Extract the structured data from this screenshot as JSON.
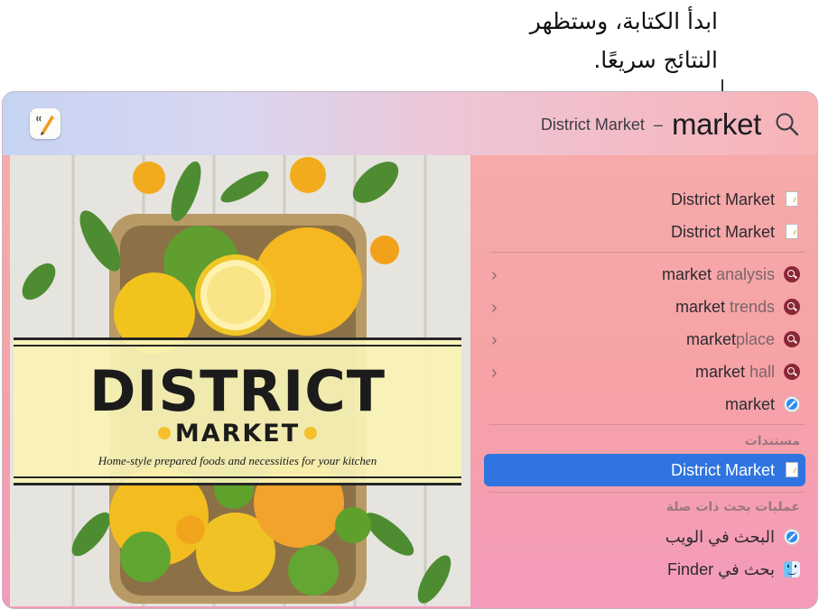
{
  "callout": {
    "line1": "ابدأ الكتابة، وستظهر",
    "line2": "النتائج سريعًا."
  },
  "app": {
    "icon": "pages-app-icon"
  },
  "search": {
    "query": "market",
    "hint": "District Market",
    "separator": "–",
    "icon": "magnifying-glass-icon"
  },
  "preview": {
    "title": "DISTRICT",
    "subtitle": "MARKET",
    "tagline": "Home-style prepared foods and necessities for your kitchen"
  },
  "results": {
    "top_hits": [
      {
        "label": "District Market",
        "icon": "document-icon"
      },
      {
        "label": "District Market",
        "icon": "document-icon"
      }
    ],
    "suggestions": [
      {
        "match": "market",
        "rest": " analysis",
        "icon": "search-suggestion-icon"
      },
      {
        "match": "market",
        "rest": " trends",
        "icon": "search-suggestion-icon"
      },
      {
        "match": "market",
        "rest": "place",
        "icon": "search-suggestion-icon"
      },
      {
        "match": "market",
        "rest": " hall",
        "icon": "search-suggestion-icon"
      },
      {
        "match": "market",
        "rest": "",
        "icon": "safari-icon"
      }
    ],
    "documents_header": "مستندات",
    "documents": [
      {
        "label": "District Market",
        "icon": "document-icon",
        "selected": true
      }
    ],
    "related_header": "عمليات بحث ذات صلة",
    "related": [
      {
        "label": "البحث في الويب",
        "icon": "safari-icon"
      },
      {
        "label": "بحث في Finder",
        "icon": "finder-icon"
      }
    ]
  },
  "colors": {
    "selection": "#2f74e0",
    "panel_top": "#f7adaa",
    "panel_bottom": "#f49bbb"
  }
}
